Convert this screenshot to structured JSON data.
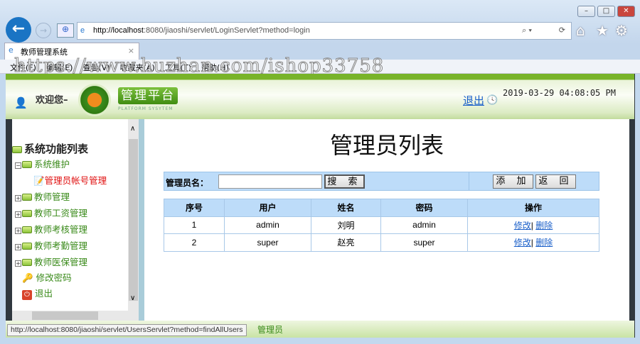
{
  "browser": {
    "url_host": "http://localhost",
    "url_rest": ":8080/jiaoshi/servlet/LoginServlet?method=login",
    "tab_title": "教师管理系统",
    "menu": [
      "文件(F)",
      "编辑(E)",
      "查看(V)",
      "收藏夹(A)",
      "工具(T)",
      "帮助(H)"
    ],
    "watermark": "https://www.huzhan.com/ishop33758",
    "status_url": "http://localhost:8080/jiaoshi/servlet/UsersServlet?method=findAllUsers"
  },
  "header": {
    "welcome": "欢迎您–",
    "platform": "管理平台",
    "platform_sub": "PLATFORM SYSYTEM",
    "logout": "退出",
    "datetime": "2019-03-29 04:08:05 PM"
  },
  "sidebar": {
    "root": "系统功能列表",
    "items": [
      {
        "label": "系统维护"
      },
      {
        "label": "管理员帐号管理"
      },
      {
        "label": "教师管理"
      },
      {
        "label": "教师工资管理"
      },
      {
        "label": "教师考核管理"
      },
      {
        "label": "教师考勤管理"
      },
      {
        "label": "教师医保管理"
      },
      {
        "label": "修改密码"
      },
      {
        "label": "退出"
      }
    ]
  },
  "main": {
    "title": "管理员列表",
    "search_label": "管理员名：",
    "search_value": "",
    "search_btn": "搜 索",
    "add_btn": "添 加",
    "back_btn": "返 回",
    "columns": [
      "序号",
      "用户",
      "姓名",
      "密码",
      "操作"
    ],
    "rows": [
      {
        "no": "1",
        "user": "admin",
        "name": "刘明",
        "pwd": "admin",
        "edit": "修改",
        "del": "删除"
      },
      {
        "no": "2",
        "user": "super",
        "name": "赵亮",
        "pwd": "super",
        "edit": "修改",
        "del": "删除"
      }
    ],
    "sep": "|"
  },
  "footer": {
    "text": "管理员"
  },
  "colors": {
    "accent": "#78b32a",
    "link": "#1a5fc9",
    "table_header": "#bddcf9"
  }
}
